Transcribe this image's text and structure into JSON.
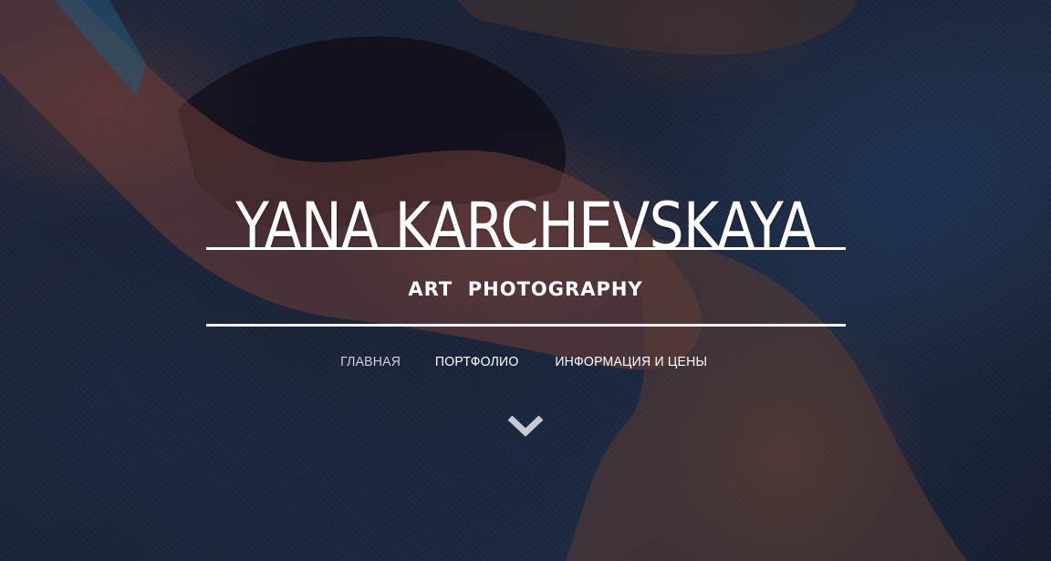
{
  "hero": {
    "title": "YANA KARCHEVSKAYA",
    "subtitle": "ART  PHOTOGRAPHY"
  },
  "nav": {
    "items": [
      {
        "label": "ГЛАВНАЯ",
        "active": true
      },
      {
        "label": "ПОРТФОЛИО",
        "active": false
      },
      {
        "label": "ИНФОРМАЦИЯ И ЦЕНЫ",
        "active": false
      }
    ]
  },
  "scroll_button": {
    "icon": "chevron-down-icon"
  },
  "colors": {
    "text": "#ffffff",
    "nav_active": "#d3cdd6",
    "background": "#1f2a40"
  }
}
